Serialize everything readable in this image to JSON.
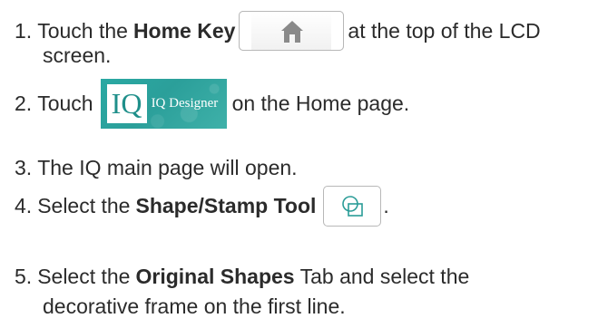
{
  "steps": [
    {
      "number": "1.",
      "pre": "Touch the",
      "bold": "Home Key",
      "post": "at the top of the LCD",
      "continuation": "screen."
    },
    {
      "number": "2.",
      "pre": "Touch",
      "tile_logo": "IQ",
      "tile_label": "IQ Designer",
      "post": "on the Home page."
    },
    {
      "number": "3.",
      "text": "The IQ main page will open."
    },
    {
      "number": "4.",
      "pre": "Select the",
      "bold": "Shape/Stamp Tool",
      "post": "."
    },
    {
      "number": "5.",
      "pre": "Select the",
      "bold": "Original Shapes",
      "post": "Tab and select the",
      "continuation": "decorative frame on the first line."
    }
  ],
  "icons": {
    "home_key": "home-icon",
    "shape_tool": "shape-stamp-icon"
  },
  "colors": {
    "text": "#2b2b2b",
    "teal": "#2aa9a3",
    "icon_gray": "#8a8a8a",
    "icon_teal": "#2a9c97"
  }
}
